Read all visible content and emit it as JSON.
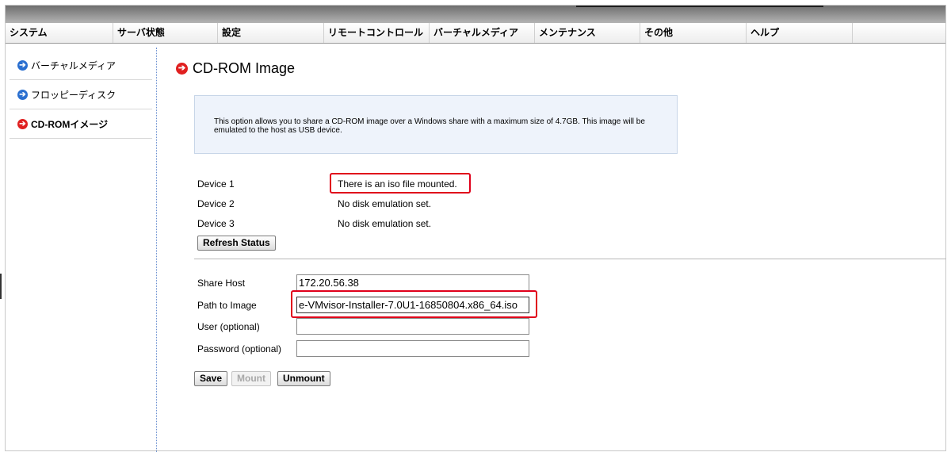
{
  "menu": {
    "items": [
      {
        "label": "システム"
      },
      {
        "label": "サーバ状態"
      },
      {
        "label": "設定"
      },
      {
        "label": "リモートコントロール"
      },
      {
        "label": "バーチャルメディア"
      },
      {
        "label": "メンテナンス"
      },
      {
        "label": "その他"
      },
      {
        "label": "ヘルプ"
      }
    ]
  },
  "sidebar": {
    "items": [
      {
        "label": "バーチャルメディア",
        "icon": "arrow-circle-icon",
        "color": "#2a6fd0"
      },
      {
        "label": "フロッピーディスク",
        "icon": "arrow-circle-icon",
        "color": "#2a6fd0"
      },
      {
        "label": "CD-ROMイメージ",
        "icon": "arrow-circle-icon",
        "color": "#e02020",
        "active": true
      }
    ]
  },
  "page": {
    "title": "CD-ROM Image",
    "info": "This option allows you to share a CD-ROM image over a Windows share with a maximum size of 4.7GB. This image will be emulated to the host as USB device."
  },
  "devices": [
    {
      "label": "Device 1",
      "status": "There is an iso file mounted."
    },
    {
      "label": "Device 2",
      "status": "No disk emulation set."
    },
    {
      "label": "Device 3",
      "status": "No disk emulation set."
    }
  ],
  "buttons": {
    "refresh": "Refresh Status",
    "save": "Save",
    "mount": "Mount",
    "unmount": "Unmount"
  },
  "form": {
    "share_host_label": "Share Host",
    "share_host_value": "172.20.56.38",
    "path_label": "Path to Image",
    "path_value": "e-VMvisor-Installer-7.0U1-16850804.x86_64.iso",
    "user_label": "User (optional)",
    "user_value": "",
    "password_label": "Password (optional)",
    "password_value": ""
  },
  "colors": {
    "highlight": "#e0001a",
    "info_bg": "#eef3fb"
  }
}
